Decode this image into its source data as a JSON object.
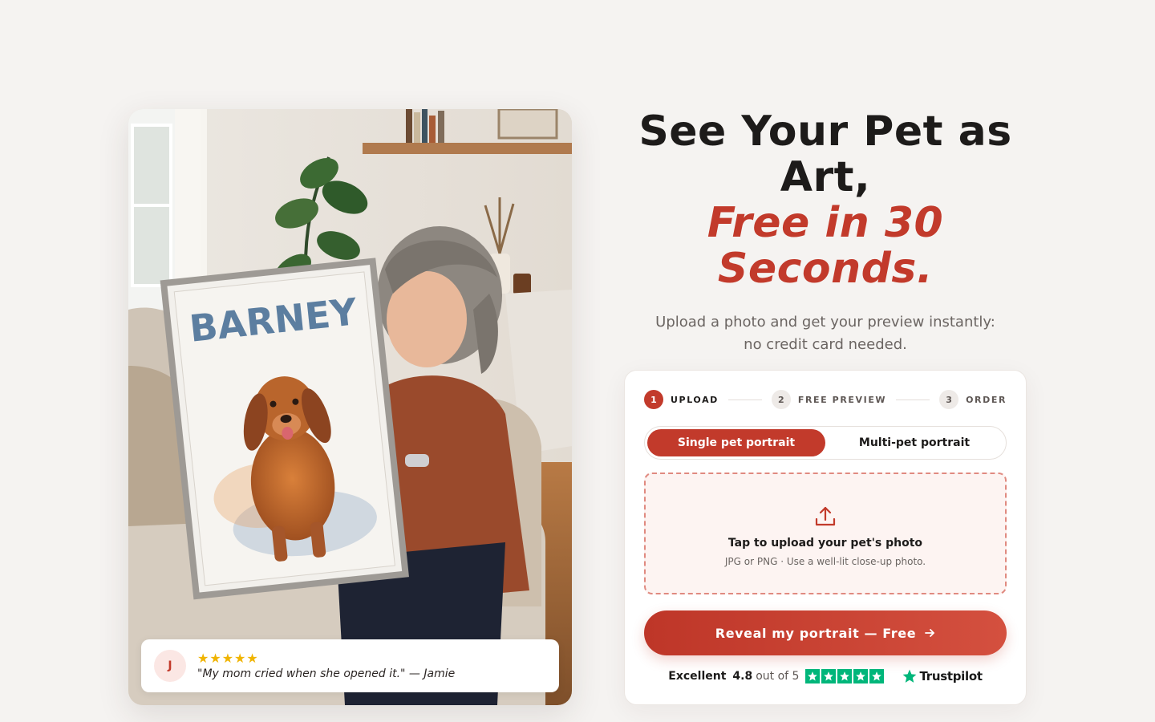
{
  "testimonial": {
    "avatar_initial": "J",
    "stars": "★★★★★",
    "quote": "\"My mom cried when she opened it.\" — Jamie",
    "rating": 5
  },
  "photo": {
    "canvas_name": "BARNEY"
  },
  "hero": {
    "title_line1": "See Your Pet as Art,",
    "title_line2": "Free in 30 Seconds.",
    "subtitle": "Upload a photo and get your preview instantly: no credit card needed."
  },
  "steps": [
    {
      "num": "1",
      "label": "UPLOAD"
    },
    {
      "num": "2",
      "label": "FREE PREVIEW"
    },
    {
      "num": "3",
      "label": "ORDER"
    }
  ],
  "toggle": {
    "single": "Single pet portrait",
    "multi": "Multi-pet portrait"
  },
  "upload": {
    "title": "Tap to upload your pet's photo",
    "hint": "JPG or PNG · Use a well-lit close-up photo.",
    "icon": "upload-icon"
  },
  "cta": {
    "label": "Reveal my portrait — Free",
    "icon": "arrow-right-icon"
  },
  "rating": {
    "excellent": "Excellent",
    "score": "4.8",
    "out_of": "out of 5",
    "brand": "Trustpilot"
  },
  "colors": {
    "accent": "#c23a2b",
    "background": "#f5f3f1",
    "trustpilot_green": "#00b67a",
    "star_gold": "#f0b400"
  }
}
